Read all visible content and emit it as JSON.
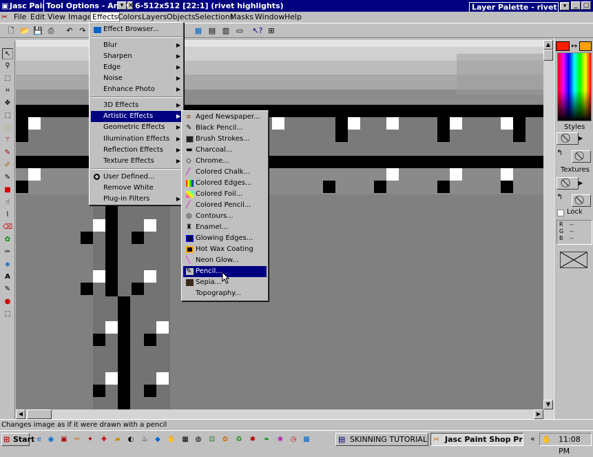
{
  "window": {
    "app_title_fragment": "Jasc Pain",
    "tool_options_title": "Tool Options - Arrow",
    "image_title_fragment": "6-512x512 [22:1] (rivet highlights)",
    "layer_palette_title": "Layer Palette - rivet hi"
  },
  "menubar": [
    "File",
    "Edit",
    "View",
    "Image",
    "Effects",
    "Colors",
    "Layers",
    "Objects",
    "Selections",
    "Masks",
    "Window",
    "Help"
  ],
  "effects_menu": {
    "items": [
      {
        "label": "Effect Browser...",
        "submenu": false,
        "icon": "effect-browser-icon"
      },
      {
        "label": "Blur",
        "submenu": true
      },
      {
        "label": "Sharpen",
        "submenu": true
      },
      {
        "label": "Edge",
        "submenu": true
      },
      {
        "label": "Noise",
        "submenu": true
      },
      {
        "label": "Enhance Photo",
        "submenu": true
      },
      {
        "label": "3D Effects",
        "submenu": true
      },
      {
        "label": "Artistic Effects",
        "submenu": true,
        "selected": true
      },
      {
        "label": "Geometric Effects",
        "submenu": true
      },
      {
        "label": "Illumination Effects",
        "submenu": true
      },
      {
        "label": "Reflection Effects",
        "submenu": true
      },
      {
        "label": "Texture Effects",
        "submenu": true
      },
      {
        "label": "User Defined...",
        "submenu": false,
        "icon": "user-defined-icon"
      },
      {
        "label": "Remove White",
        "submenu": false
      },
      {
        "label": "Plug-in Filters",
        "submenu": true
      }
    ]
  },
  "artistic_menu": {
    "items": [
      {
        "label": "Aged Newspaper...",
        "icon": "aged-newspaper-icon"
      },
      {
        "label": "Black Pencil...",
        "icon": "black-pencil-icon"
      },
      {
        "label": "Brush Strokes...",
        "icon": "brush-strokes-icon"
      },
      {
        "label": "Charcoal...",
        "icon": "charcoal-icon"
      },
      {
        "label": "Chrome...",
        "icon": "chrome-icon"
      },
      {
        "label": "Colored Chalk...",
        "icon": "colored-chalk-icon"
      },
      {
        "label": "Colored Edges...",
        "icon": "colored-edges-icon"
      },
      {
        "label": "Colored Foil...",
        "icon": "colored-foil-icon"
      },
      {
        "label": "Colored Pencil...",
        "icon": "colored-pencil-icon"
      },
      {
        "label": "Contours...",
        "icon": "contours-icon"
      },
      {
        "label": "Enamel...",
        "icon": "enamel-icon"
      },
      {
        "label": "Glowing Edges...",
        "icon": "glowing-edges-icon"
      },
      {
        "label": "Hot Wax Coating",
        "icon": "hot-wax-icon"
      },
      {
        "label": "Neon Glow...",
        "icon": "neon-glow-icon"
      },
      {
        "label": "Pencil...",
        "icon": "pencil-icon",
        "selected": true
      },
      {
        "label": "Sepia...",
        "icon": "sepia-icon"
      },
      {
        "label": "Topography...",
        "icon": "topography-icon"
      }
    ]
  },
  "palette": {
    "foreground_color": "#ff2000",
    "background_color": "#ffa000",
    "styles_label": "Styles",
    "textures_label": "Textures",
    "lock_label": "Lock",
    "rgb_labels": [
      "R",
      "G",
      "B"
    ],
    "rgb_values": [
      "--",
      "--",
      "--"
    ]
  },
  "statusbar": {
    "text": "Changes image as if it were drawn with a pencil"
  },
  "taskbar": {
    "start_label": "Start",
    "tasks": [
      "SKINNING TUTORIAL - ...",
      "Jasc Paint Shop Pro ..."
    ],
    "clock": "11:08 PM",
    "tray_arrows": "«"
  }
}
